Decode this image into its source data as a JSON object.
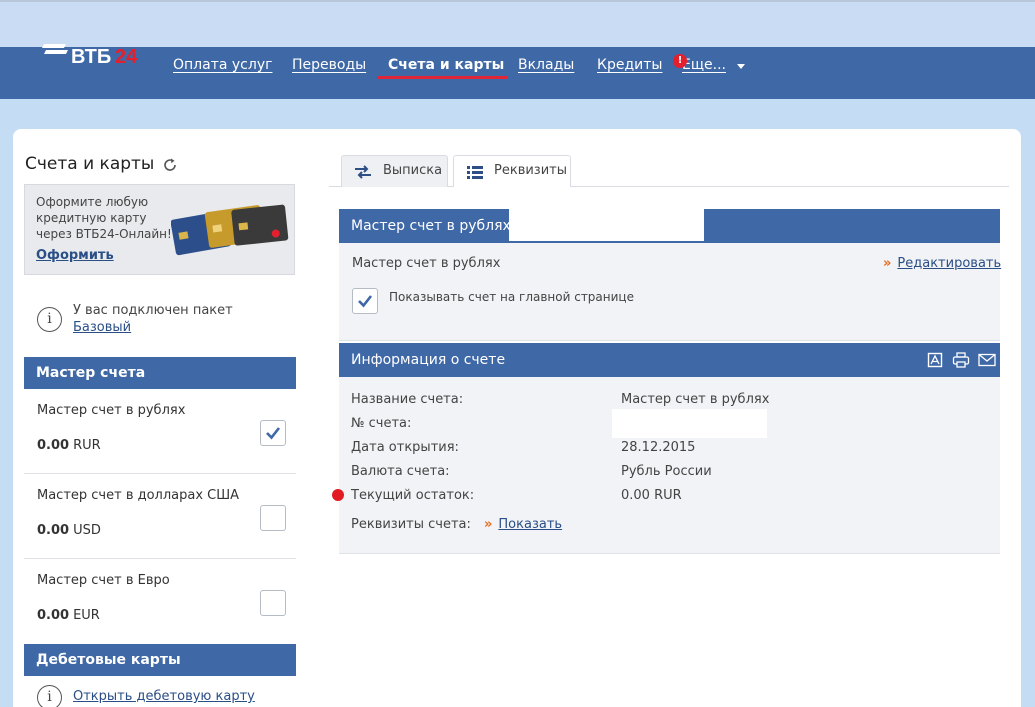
{
  "brand": {
    "name": "ВТБ",
    "num": "24"
  },
  "nav": {
    "items": [
      {
        "label": "Оплата услуг"
      },
      {
        "label": "Переводы"
      },
      {
        "label": "Счета и карты"
      },
      {
        "label": "Вклады"
      },
      {
        "label": "Кредиты"
      },
      {
        "label": "Еще..."
      }
    ],
    "alert": "!"
  },
  "sidebar": {
    "title": "Счета и карты",
    "promo": {
      "text": "Оформите любую кредитную карту через ВТБ24-Онлайн!",
      "link": "Оформить"
    },
    "package": {
      "text": "У вас подключен пакет",
      "link": "Базовый"
    },
    "master_header": "Мастер счета",
    "accounts": [
      {
        "name": "Мастер счет в рублях",
        "amount": "0.00",
        "currency": "RUR",
        "checked": true
      },
      {
        "name": "Мастер счет в долларах США",
        "amount": "0.00",
        "currency": "USD",
        "checked": false
      },
      {
        "name": "Мастер счет в Евро",
        "amount": "0.00",
        "currency": "EUR",
        "checked": false
      }
    ],
    "debit_header": "Дебетовые карты",
    "open_debit": "Открыть дебетовую карту"
  },
  "main": {
    "tabs": [
      {
        "label": "Выписка"
      },
      {
        "label": "Реквизиты"
      }
    ],
    "account_header": "Мастер счет в рублях",
    "account_name": "Мастер счет в рублях",
    "edit_link": "Редактировать",
    "show_on_main": "Показывать счет на главной странице",
    "info_header": "Информация о счете",
    "details": {
      "labels": [
        "Название счета:",
        "№ счета:",
        "Дата открытия:",
        "Валюта счета:",
        "Текущий остаток:"
      ],
      "values": [
        "Мастер счет в рублях",
        "",
        "28.12.2015",
        "Рубль России",
        "0.00 RUR"
      ]
    },
    "requisites_label": "Реквизиты счета:",
    "requisites_link": "Показать"
  },
  "colors": {
    "primary": "#3f68a6",
    "accent": "#e22536",
    "link": "#2a4e86"
  }
}
